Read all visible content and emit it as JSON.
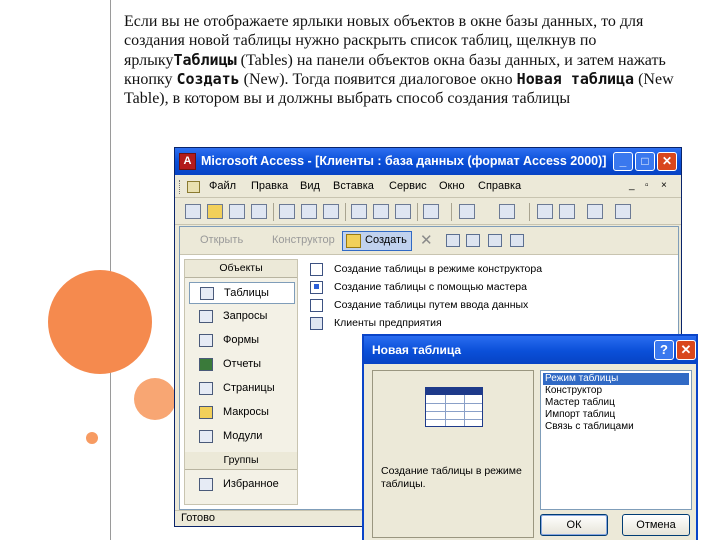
{
  "intro": {
    "part1": "Если вы не отображаете ярлыки новых объектов в окне базы данных, то для создания новой таблицы нужно раскрыть список таблиц, щелкнув по ярлыку",
    "bold1": "Таблицы",
    "part2": " (Tables) на панели объектов окна базы данных, и затем нажать кнопку ",
    "bold2": "Создать",
    "part3": " (New). Тогда появится диалоговое окно ",
    "bold3": "Новая таблица",
    "part4": " (New Table), в котором вы и должны выбрать способ создания таблицы"
  },
  "window": {
    "title": "Microsoft Access - [Клиенты : база данных (формат Access 2000)]",
    "minimize": "_",
    "restore": "□",
    "close": "✕"
  },
  "menu": {
    "items": [
      "Файл",
      "Правка",
      "Вид",
      "Вставка",
      "Сервис",
      "Окно",
      "Справка"
    ],
    "mdi_minimize": "_",
    "mdi_restore": "▫",
    "mdi_close": "×"
  },
  "db_toolbar": {
    "open": "Открыть",
    "design": "Конструктор",
    "create": "Создать",
    "delete": "✕"
  },
  "objects": {
    "header": "Объекты",
    "items": [
      "Таблицы",
      "Запросы",
      "Формы",
      "Отчеты",
      "Страницы",
      "Макросы",
      "Модули"
    ],
    "groups_header": "Группы",
    "favorites": "Избранное"
  },
  "list": {
    "rows": [
      "Создание таблицы в режиме конструктора",
      "Создание таблицы с помощью мастера",
      "Создание таблицы путем ввода данных",
      "Клиенты предприятия"
    ]
  },
  "status": {
    "text": "Готово"
  },
  "dialog": {
    "title": "Новая таблица",
    "help": "?",
    "close": "✕",
    "description": "Создание таблицы в режиме таблицы.",
    "options": [
      "Режим таблицы",
      "Конструктор",
      "Мастер таблиц",
      "Импорт таблиц",
      "Связь с таблицами"
    ],
    "selected_index": 0,
    "ok": "ОК",
    "cancel": "Отмена"
  },
  "colors": {
    "accent_orange": "#f58a4e",
    "titlebar_blue": "#0a4fd8",
    "selection_blue": "#316ac5"
  }
}
